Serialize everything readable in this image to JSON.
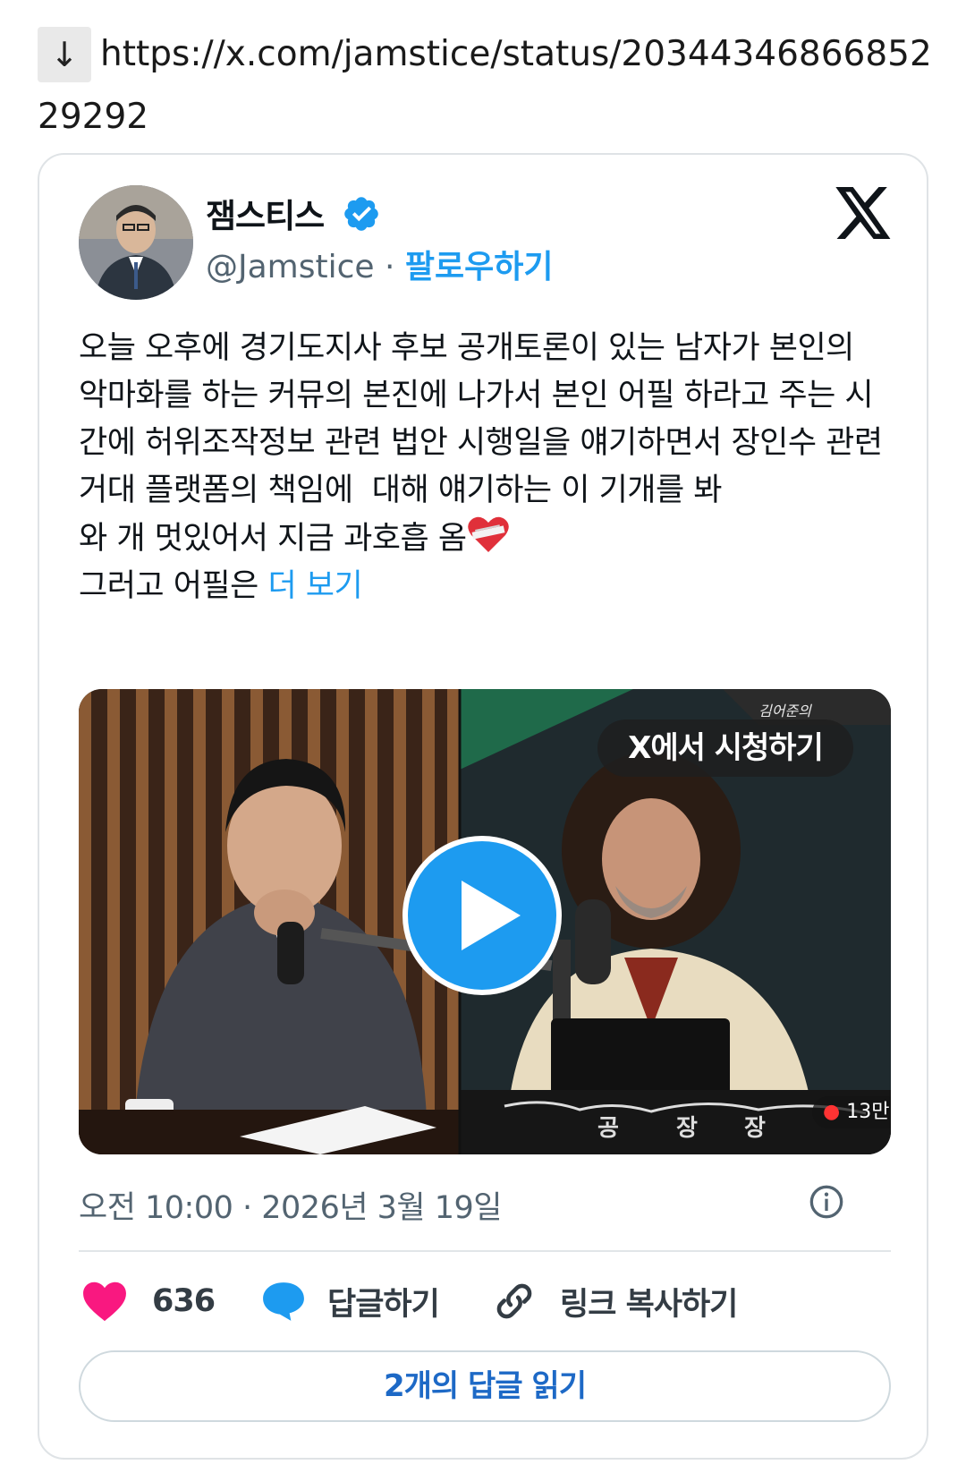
{
  "link": {
    "arrow": "↓",
    "url": "https://x.com/jamstice/status/2034434686685229292"
  },
  "tweet": {
    "display_name": "잼스티스",
    "handle": "@Jamstice",
    "separator": " · ",
    "follow_label": "팔로우하기",
    "text": "오늘 오후에 경기도지사 후보 공개토론이 있는 남자가 본인의 악마화를 하는 커뮤의 본진에 나가서 본인 어필 하라고 주는 시간에 허위조작정보 관련 법안 시행일을 얘기하면서 장인수 관련 거대 플랫폼의 책임에  대해 얘기하는 이 기개를 봐\n와 개 멋있어서 지금 과호흡 옴",
    "text_tail": "그러고 어필은 ",
    "more_label": "더 보기",
    "emoji": "mending-heart-emoji",
    "timestamp": "오전 10:00 · 2026년 3월 19일"
  },
  "media": {
    "watch_label": "X에서 시청하기",
    "viewer_count": "13만",
    "nameplate": [
      "공",
      "장",
      "장"
    ]
  },
  "actions": {
    "like_count": "636",
    "reply_label": "답글하기",
    "copy_link_label": "링크 복사하기",
    "read_replies_label": "2개의 답글 읽기"
  },
  "colors": {
    "accent": "#1d9bf0",
    "like": "#f91880",
    "muted": "#536471"
  }
}
